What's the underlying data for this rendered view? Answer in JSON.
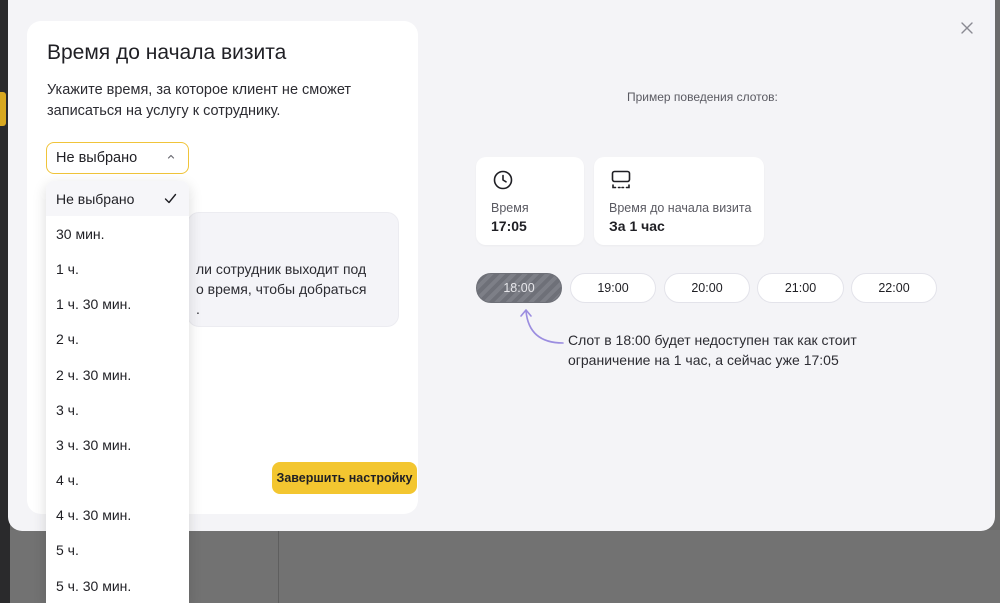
{
  "modal": {
    "title": "Время до начала визита",
    "description": "Укажите время, за которое клиент не сможет записаться на услугу к сотруднику."
  },
  "select": {
    "value": "Не выбрано",
    "options": [
      "Не выбрано",
      "30 мин.",
      "1 ч.",
      "1 ч. 30 мин.",
      "2 ч.",
      "2 ч. 30 мин.",
      "3 ч.",
      "3 ч. 30 мин.",
      "4 ч.",
      "4 ч. 30 мин.",
      "5 ч.",
      "5 ч. 30 мин."
    ],
    "selected_index": 0
  },
  "info_box": {
    "text": "ли сотрудник выходит под\nо время, чтобы добраться\n."
  },
  "finish_button": "Завершить настройку",
  "preview": {
    "label": "Пример поведения слотов:",
    "time_card": {
      "label": "Время",
      "value": "17:05",
      "icon": "clock-icon"
    },
    "before_card": {
      "label": "Время до начала визита",
      "value": "За 1 час",
      "icon": "slot-frame-icon"
    },
    "slots": [
      {
        "time": "18:00",
        "disabled": true
      },
      {
        "time": "19:00",
        "disabled": false
      },
      {
        "time": "20:00",
        "disabled": false
      },
      {
        "time": "21:00",
        "disabled": false
      },
      {
        "time": "22:00",
        "disabled": false
      }
    ],
    "note": "Слот в 18:00 будет недоступен так как стоит ограничение на 1 час, а сейчас уже 17:05"
  },
  "colors": {
    "accent": "#f3c630",
    "select_border": "#f0c43a",
    "disabled_slot": "#7d7f87",
    "arrow": "#9b8de0"
  }
}
